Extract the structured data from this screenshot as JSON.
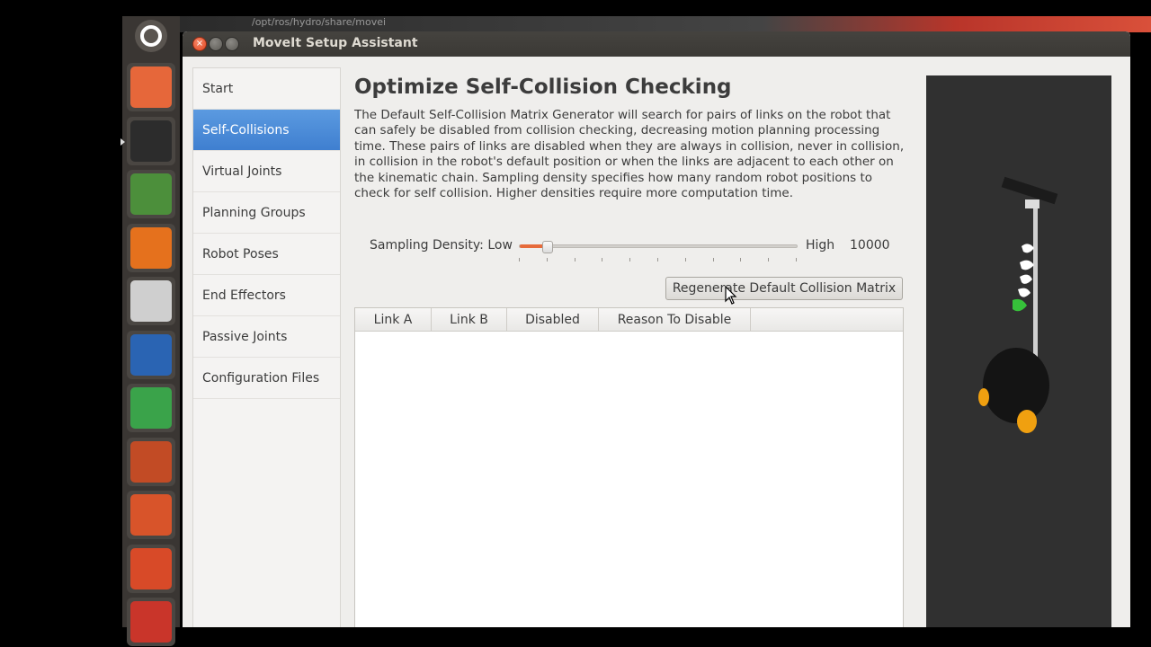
{
  "window": {
    "title": "MoveIt Setup Assistant",
    "close_glyph": "×"
  },
  "top_strip": {
    "path_text": "/opt/ros/hydro/share/movei"
  },
  "launcher": {
    "icons": [
      {
        "name": "files-icon",
        "color": "#e6673a"
      },
      {
        "name": "terminal-icon",
        "color": "#2c2c2c"
      },
      {
        "name": "chrome-icon",
        "color": "#4c8f3b"
      },
      {
        "name": "firefox-icon",
        "color": "#e5711d"
      },
      {
        "name": "text-editor-icon",
        "color": "#cfcfcf"
      },
      {
        "name": "writer-icon",
        "color": "#2a64b3"
      },
      {
        "name": "calc-icon",
        "color": "#3aa34a"
      },
      {
        "name": "impress-icon",
        "color": "#c24b25"
      },
      {
        "name": "software-center-icon",
        "color": "#d8542a"
      },
      {
        "name": "ubuntu-one-icon",
        "color": "#d84a28"
      },
      {
        "name": "settings-icon",
        "color": "#c9352a"
      }
    ]
  },
  "nav": {
    "items": [
      {
        "label": "Start",
        "active": false
      },
      {
        "label": "Self-Collisions",
        "active": true
      },
      {
        "label": "Virtual Joints",
        "active": false
      },
      {
        "label": "Planning Groups",
        "active": false
      },
      {
        "label": "Robot Poses",
        "active": false
      },
      {
        "label": "End Effectors",
        "active": false
      },
      {
        "label": "Passive Joints",
        "active": false
      },
      {
        "label": "Configuration Files",
        "active": false
      }
    ]
  },
  "main": {
    "title": "Optimize Self-Collision Checking",
    "description": "The Default Self-Collision Matrix Generator will search for pairs of links on the robot that can safely be disabled from collision checking, decreasing motion planning processing time. These pairs of links are disabled when they are always in collision, never in collision, in collision in the robot's default position or when the links are adjacent to each other on the kinematic chain. Sampling density specifies how many random robot positions to check for self collision. Higher densities require more computation time.",
    "density_label": "Sampling Density: Low",
    "high_label": "High",
    "density_value": "10000",
    "slider_fraction": 0.1,
    "regen_button": "Regenerate Default Collision Matrix",
    "table": {
      "columns": [
        "Link A",
        "Link B",
        "Disabled",
        "Reason To Disable"
      ],
      "rows": []
    }
  },
  "colors": {
    "accent": "#4a8ad8",
    "slider_fill": "#e66b3b",
    "viz_background": "#303030"
  }
}
